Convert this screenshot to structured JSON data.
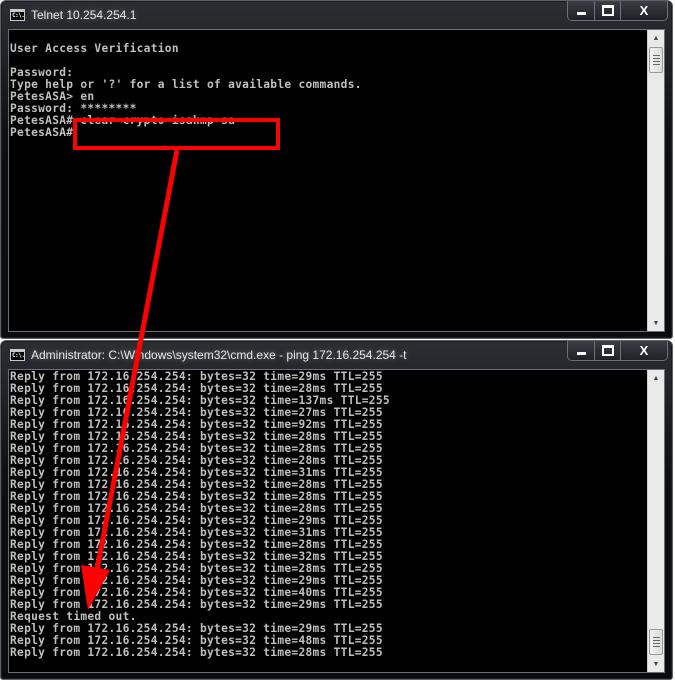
{
  "telnet_window": {
    "title": "Telnet 10.254.254.1",
    "icon": "console-icon",
    "icon_text": "C:\\.",
    "buttons": {
      "minimize": "minimize-icon",
      "maximize": "maximize-icon",
      "close": "X"
    },
    "lines": [
      "",
      "User Access Verification",
      "",
      "Password:",
      "Type help or '?' for a list of available commands.",
      "PetesASA> en",
      "Password: ********",
      "PetesASA# clear crypto isakmp sa",
      "PetesASA#"
    ],
    "highlighted_command": "clear crypto isakmp sa"
  },
  "cmd_window": {
    "title": "Administrator: C:\\Windows\\system32\\cmd.exe - ping  172.16.254.254 -t",
    "icon": "console-icon",
    "icon_text": "C:\\.",
    "buttons": {
      "minimize": "minimize-icon",
      "maximize": "maximize-icon",
      "close": "X"
    },
    "lines": [
      "Reply from 172.16.254.254: bytes=32 time=29ms TTL=255",
      "Reply from 172.16.254.254: bytes=32 time=28ms TTL=255",
      "Reply from 172.16.254.254: bytes=32 time=137ms TTL=255",
      "Reply from 172.16.254.254: bytes=32 time=27ms TTL=255",
      "Reply from 172.16.254.254: bytes=32 time=92ms TTL=255",
      "Reply from 172.16.254.254: bytes=32 time=28ms TTL=255",
      "Reply from 172.16.254.254: bytes=32 time=28ms TTL=255",
      "Reply from 172.16.254.254: bytes=32 time=28ms TTL=255",
      "Reply from 172.16.254.254: bytes=32 time=31ms TTL=255",
      "Reply from 172.16.254.254: bytes=32 time=28ms TTL=255",
      "Reply from 172.16.254.254: bytes=32 time=28ms TTL=255",
      "Reply from 172.16.254.254: bytes=32 time=28ms TTL=255",
      "Reply from 172.16.254.254: bytes=32 time=29ms TTL=255",
      "Reply from 172.16.254.254: bytes=32 time=31ms TTL=255",
      "Reply from 172.16.254.254: bytes=32 time=28ms TTL=255",
      "Reply from 172.16.254.254: bytes=32 time=32ms TTL=255",
      "Reply from 172.16.254.254: bytes=32 time=28ms TTL=255",
      "Reply from 172.16.254.254: bytes=32 time=29ms TTL=255",
      "Reply from 172.16.254.254: bytes=32 time=40ms TTL=255",
      "Reply from 172.16.254.254: bytes=32 time=29ms TTL=255",
      "Request timed out.",
      "Reply from 172.16.254.254: bytes=32 time=29ms TTL=255",
      "Reply from 172.16.254.254: bytes=32 time=48ms TTL=255",
      "Reply from 172.16.254.254: bytes=32 time=28ms TTL=255"
    ]
  },
  "annotation": {
    "color": "#ff0000",
    "description": "Red box around command with arrow pointing to 'Request timed out.'"
  }
}
